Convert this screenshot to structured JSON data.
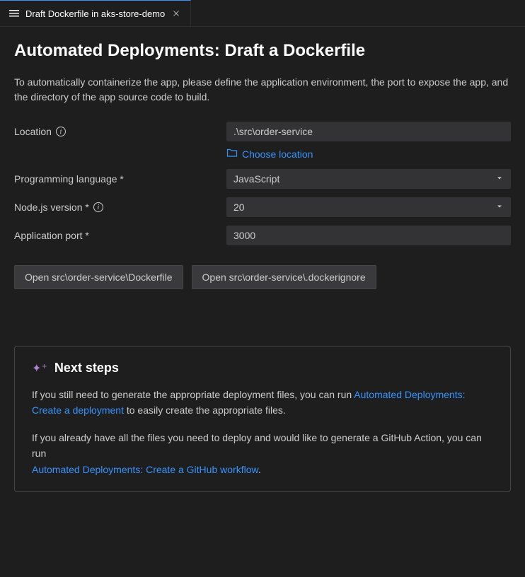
{
  "tab": {
    "title": "Draft Dockerfile in aks-store-demo"
  },
  "page": {
    "title": "Automated Deployments: Draft a Dockerfile",
    "description": "To automatically containerize the app, please define the application environment, the port to expose the app, and the directory of the app source code to build."
  },
  "form": {
    "location": {
      "label": "Location",
      "value": ".\\src\\order-service",
      "choose_label": "Choose location"
    },
    "language": {
      "label": "Programming language *",
      "value": "JavaScript"
    },
    "nodeVersion": {
      "label": "Node.js version *",
      "value": "20"
    },
    "port": {
      "label": "Application port *",
      "value": "3000"
    }
  },
  "buttons": {
    "open_dockerfile": "Open src\\order-service\\Dockerfile",
    "open_dockerignore": "Open src\\order-service\\.dockerignore"
  },
  "nextSteps": {
    "title": "Next steps",
    "para1_before": "If you still need to generate the appropriate deployment files, you can run ",
    "para1_link": "Automated Deployments: Create a deployment",
    "para1_after": " to easily create the appropriate files.",
    "para2_before": "If you already have all the files you need to deploy and would like to generate a GitHub Action, you can run ",
    "para2_link": "Automated Deployments: Create a GitHub workflow",
    "para2_after": "."
  }
}
